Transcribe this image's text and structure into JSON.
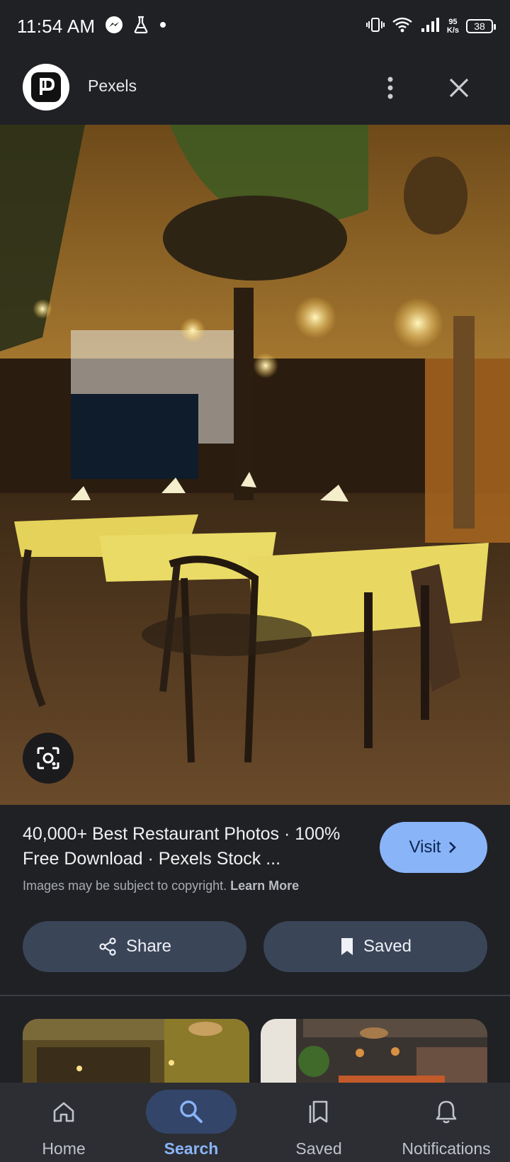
{
  "status_bar": {
    "time": "11:54 AM",
    "net_speed_value": "95",
    "net_speed_unit": "K/s",
    "battery": "38"
  },
  "header": {
    "site_name": "Pexels"
  },
  "result": {
    "title": "40,000+ Best Restaurant Photos · 100% Free Download · Pexels Stock ...",
    "copyright_text": "Images may be subject to copyright.",
    "learn_more": "Learn More",
    "visit_label": "Visit"
  },
  "actions": {
    "share_label": "Share",
    "saved_label": "Saved"
  },
  "bottom_nav": {
    "items": [
      {
        "label": "Home",
        "icon": "home-icon"
      },
      {
        "label": "Search",
        "icon": "search-icon",
        "active": true
      },
      {
        "label": "Saved",
        "icon": "saved-icon"
      },
      {
        "label": "Notifications",
        "icon": "bell-icon"
      }
    ]
  },
  "colors": {
    "background": "#1f2125",
    "accent": "#8ab4f8",
    "button": "#3a4558",
    "nav_bg": "#2c2e33"
  }
}
